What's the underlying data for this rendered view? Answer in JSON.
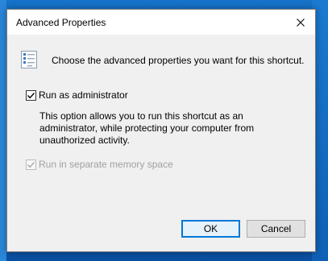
{
  "dialog": {
    "title": "Advanced Properties",
    "close_icon": "close-icon",
    "header_icon": "properties-list-icon",
    "header_text": "Choose the advanced properties you want for this shortcut.",
    "run_as_admin": {
      "label": "Run as administrator",
      "checked": true,
      "enabled": true
    },
    "description": "This option allows you to run this shortcut as an administrator, while protecting your computer from unauthorized activity.",
    "separate_memory": {
      "label": "Run in separate memory space",
      "checked": true,
      "enabled": false
    },
    "buttons": {
      "ok": "OK",
      "cancel": "Cancel"
    }
  },
  "colors": {
    "accent": "#0078d7",
    "desktop": "#0b63b6",
    "dialog_bg": "#f0f0f0"
  }
}
